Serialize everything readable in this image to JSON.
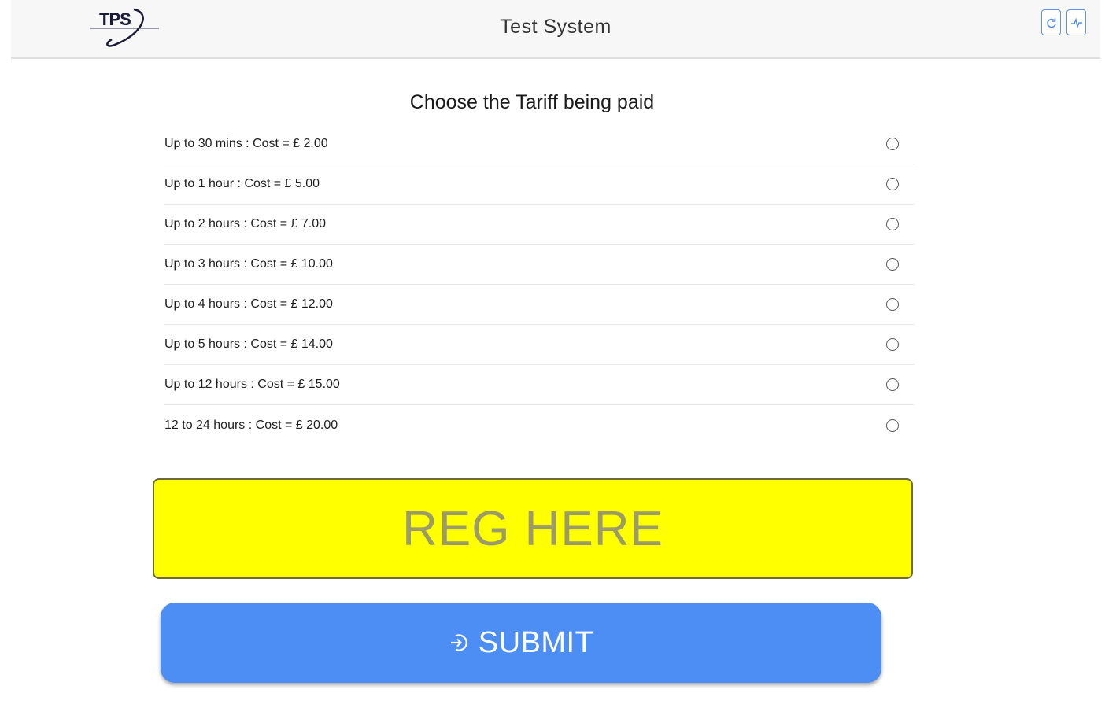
{
  "header": {
    "logo_text": "TPS",
    "title": "Test System",
    "icons": [
      {
        "name": "refresh-icon"
      },
      {
        "name": "activity-icon"
      }
    ],
    "accent_color": "#5a93e8"
  },
  "tariff": {
    "title": "Choose the Tariff being paid",
    "options": [
      {
        "label": "Up to 30 mins : Cost = £ 2.00",
        "selected": false
      },
      {
        "label": "Up to 1 hour : Cost = £ 5.00",
        "selected": false
      },
      {
        "label": "Up to 2 hours : Cost = £ 7.00",
        "selected": false
      },
      {
        "label": "Up to 3 hours : Cost = £ 10.00",
        "selected": false
      },
      {
        "label": "Up to 4 hours : Cost = £ 12.00",
        "selected": false
      },
      {
        "label": "Up to 5 hours : Cost = £ 14.00",
        "selected": false
      },
      {
        "label": "Up to 12 hours : Cost = £ 15.00",
        "selected": false
      },
      {
        "label": "12 to 24 hours : Cost = £ 20.00",
        "selected": false
      }
    ]
  },
  "reg_input": {
    "placeholder": "REG HERE",
    "value": "",
    "background_color": "#ffff00"
  },
  "submit": {
    "label": "SUBMIT",
    "icon": "login-arrow-icon",
    "background_color": "#4d8ef5"
  }
}
